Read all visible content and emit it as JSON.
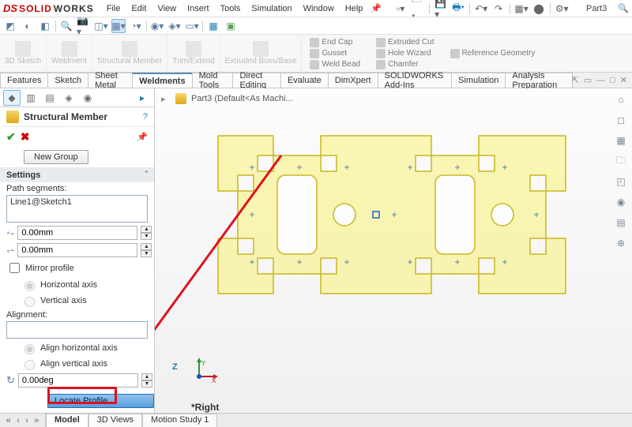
{
  "app": {
    "brand_solid": "SOLID",
    "brand_works": "WORKS",
    "ds": "DS"
  },
  "menus": [
    "File",
    "Edit",
    "View",
    "Insert",
    "Tools",
    "Simulation",
    "Window",
    "Help"
  ],
  "doc_name": "Part3",
  "ribbon": {
    "groups": [
      {
        "label": "3D Sketch"
      },
      {
        "label": "Weldment"
      },
      {
        "label": "Structural Member"
      },
      {
        "label": "Trim/Extend"
      },
      {
        "label": "Extruded Boss/Base"
      }
    ],
    "cmds_col1": [
      "End Cap",
      "Gusset",
      "Weld Bead"
    ],
    "cmds_col2": [
      "Extruded Cut",
      "Hole Wizard",
      "Chamfer"
    ],
    "cmds_col3": [
      "Reference Geometry"
    ]
  },
  "tabs": [
    "Features",
    "Sketch",
    "Sheet Metal",
    "Weldments",
    "Mold Tools",
    "Direct Editing",
    "Evaluate",
    "DimXpert",
    "SOLIDWORKS Add-Ins",
    "Simulation",
    "Analysis Preparation"
  ],
  "active_tab": "Weldments",
  "panel": {
    "title": "Structural Member",
    "new_group": "New Group",
    "settings_head": "Settings",
    "path_segments_label": "Path segments:",
    "path_segment_item": "Line1@Sketch1",
    "offset_g1": "0.00mm",
    "offset_g2": "0.00mm",
    "mirror_label": "Mirror profile",
    "horiz_axis": "Horizontal axis",
    "vert_axis": "Vertical axis",
    "alignment_label": "Alignment:",
    "align_h": "Align horizontal axis",
    "align_v": "Align vertical axis",
    "angle": "0.00deg",
    "locate_btn": "Locate Profile"
  },
  "crumb": "Part3  (Default<As Machi...",
  "canvas": {
    "right_label": "*Right",
    "axes": {
      "x": "X",
      "y": "Y",
      "z": "Z"
    }
  },
  "bottom_tabs": [
    "Model",
    "3D Views",
    "Motion Study 1"
  ],
  "active_bottom_tab": "Model"
}
